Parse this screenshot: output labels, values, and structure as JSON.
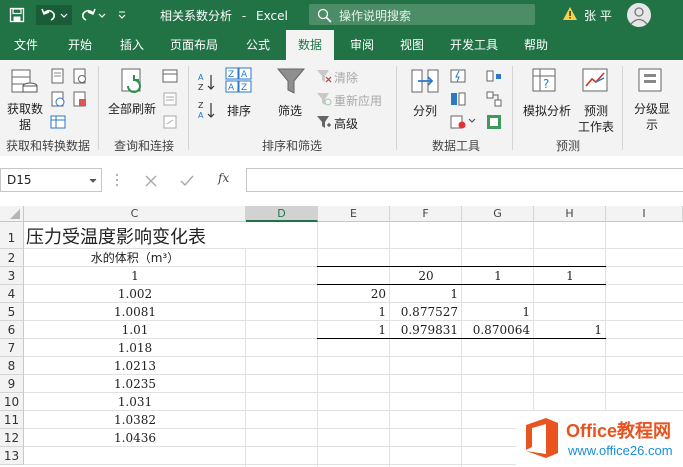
{
  "titlebar": {
    "filename": "相关系数分析",
    "app": "Excel",
    "title_sep": "-",
    "search_placeholder": "操作说明搜索",
    "user": "张 平"
  },
  "tabs": [
    "文件",
    "开始",
    "插入",
    "页面布局",
    "公式",
    "数据",
    "审阅",
    "视图",
    "开发工具",
    "帮助"
  ],
  "active_tab": "数据",
  "ribbon": {
    "get_data": "获取数",
    "get_data2": "据",
    "refresh_all": "全部刷新",
    "sort": "排序",
    "filter": "筛选",
    "clear": "清除",
    "reapply": "重新应用",
    "advanced": "高级",
    "split": "分列",
    "what_if": "模拟分析",
    "forecast": "预测",
    "forecast2": "工作表",
    "outline": "分级显",
    "outline2": "示",
    "groups": {
      "get_transform": "获取和转换数据",
      "queries": "查询和连接",
      "sort_filter": "排序和筛选",
      "data_tools": "数据工具",
      "forecast": "预测"
    }
  },
  "formula_bar": {
    "name_box": "D15",
    "fx": "fx",
    "value": ""
  },
  "sheet": {
    "columns": [
      "C",
      "D",
      "E",
      "F",
      "G",
      "H",
      "I"
    ],
    "rows": [
      "1",
      "2",
      "3",
      "4",
      "5",
      "6",
      "7",
      "8",
      "9",
      "10",
      "11",
      "12",
      "13"
    ],
    "selected_column": "D",
    "title": "压力受温度影响变化表",
    "col_c_header": "水的体积（m³）",
    "col_c_values": [
      "1",
      "1.002",
      "1.0081",
      "1.01",
      "1.018",
      "1.0213",
      "1.0235",
      "1.031",
      "1.0382",
      "1.0436"
    ],
    "corr_row3": [
      "20",
      "1",
      "1"
    ],
    "corr_row4": [
      "20",
      "1"
    ],
    "corr_row5": [
      "1",
      "0.877527",
      "1"
    ],
    "corr_row6": [
      "1",
      "0.979831",
      "0.870064",
      "1"
    ]
  },
  "watermark": {
    "brand": "Office教程网",
    "url": "www.office26.com"
  },
  "colors": {
    "excel_green": "#217346",
    "watermark_orange": "#e8531f",
    "watermark_blue": "#1a8ed6"
  }
}
